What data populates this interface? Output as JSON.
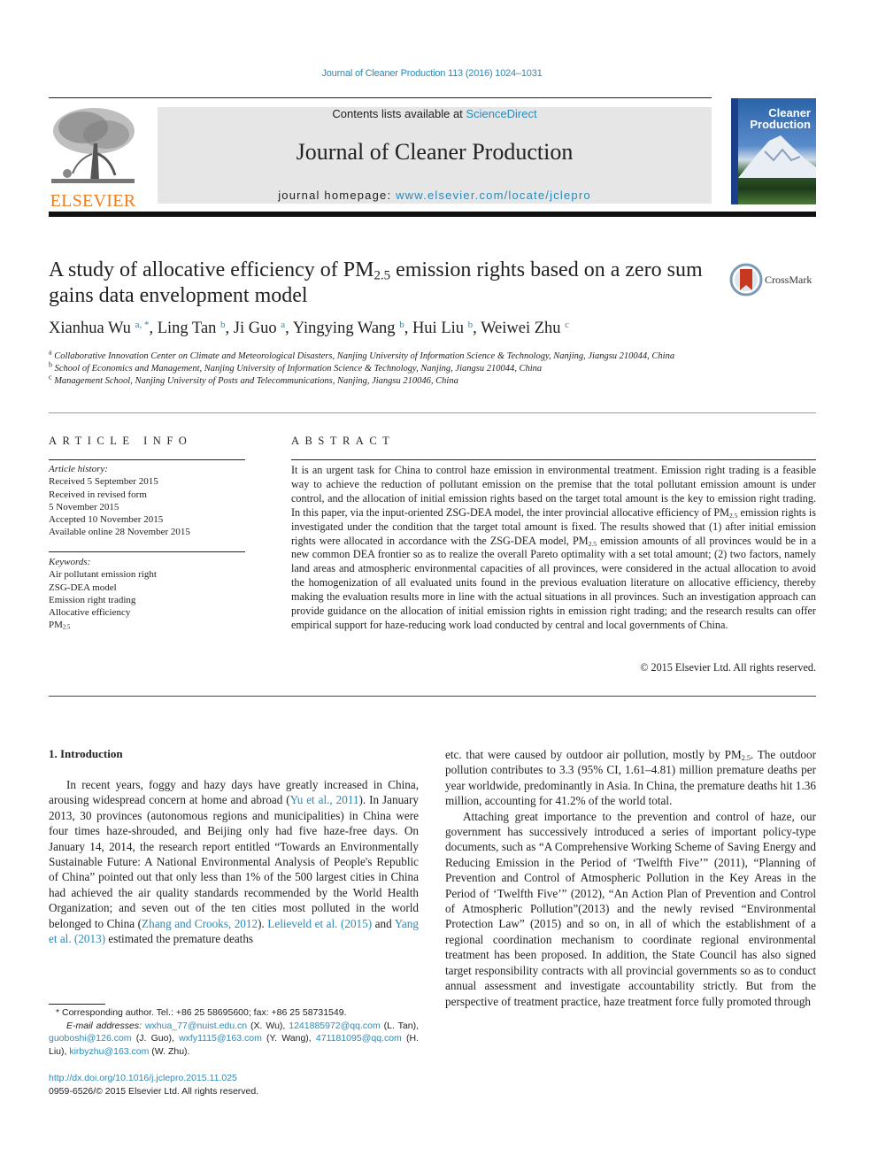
{
  "citation": "Journal of Cleaner Production 113 (2016) 1024–1031",
  "header": {
    "publisher_logo_text": "ELSEVIER",
    "contents_prefix": "Contents lists available at ",
    "contents_link": "ScienceDirect",
    "journal_name": "Journal of Cleaner Production",
    "homepage_prefix": "journal homepage: ",
    "homepage_link": "www.elsevier.com/locate/jclepro",
    "cover_title_line1": "Cleaner",
    "cover_title_line2": "Production",
    "colors": {
      "link": "#2a8ab8",
      "elsevier_orange": "#f07d1e",
      "banner_bg": "#e6e6e6"
    }
  },
  "article": {
    "title_part1": "A study of allocative efficiency of PM",
    "title_sub": "2.5",
    "title_part2": " emission rights based on a zero sum gains data envelopment model",
    "crossmark_label": "CrossMark",
    "authors": [
      {
        "name": "Xianhua Wu",
        "sup": "a, *"
      },
      {
        "name": "Ling Tan",
        "sup": "b"
      },
      {
        "name": "Ji Guo",
        "sup": "a"
      },
      {
        "name": "Yingying Wang",
        "sup": "b"
      },
      {
        "name": "Hui Liu",
        "sup": "b"
      },
      {
        "name": "Weiwei Zhu",
        "sup": "c"
      }
    ],
    "affiliations": [
      {
        "mark": "a",
        "text": "Collaborative Innovation Center on Climate and Meteorological Disasters, Nanjing University of Information Science & Technology, Nanjing, Jiangsu 210044, China"
      },
      {
        "mark": "b",
        "text": "School of Economics and Management, Nanjing University of Information Science & Technology, Nanjing, Jiangsu 210044, China"
      },
      {
        "mark": "c",
        "text": "Management School, Nanjing University of Posts and Telecommunications, Nanjing, Jiangsu 210046, China"
      }
    ]
  },
  "article_info": {
    "heading": "ARTICLE INFO",
    "history_label": "Article history:",
    "history": [
      "Received 5 September 2015",
      "Received in revised form",
      "5 November 2015",
      "Accepted 10 November 2015",
      "Available online 28 November 2015"
    ],
    "keywords_label": "Keywords:",
    "keywords": [
      "Air pollutant emission right",
      "ZSG-DEA model",
      "Emission right trading",
      "Allocative efficiency"
    ],
    "keyword_pm": "PM",
    "keyword_pm_sub": "2.5"
  },
  "abstract": {
    "heading": "ABSTRACT",
    "part1": "It is an urgent task for China to control haze emission in environmental treatment. Emission right trading is a feasible way to achieve the reduction of pollutant emission on the premise that the total pollutant emission amount is under control, and the allocation of initial emission rights based on the target total amount is the key to emission right trading. In this paper, via the input-oriented ZSG-DEA model, the inter provincial allocative efficiency of PM",
    "sub1": "2.5",
    "part2": " emission rights is investigated under the condition that the target total amount is fixed. The results showed that (1) after initial emission rights were allocated in accordance with the ZSG-DEA model, PM",
    "sub2": "2.5",
    "part3": " emission amounts of all provinces would be in a new common DEA frontier so as to realize the overall Pareto optimality with a set total amount; (2) two factors, namely land areas and atmospheric environmental capacities of all provinces, were considered in the actual allocation to avoid the homogenization of all evaluated units found in the previous evaluation literature on allocative efficiency, thereby making the evaluation results more in line with the actual situations in all provinces. Such an investigation approach can provide guidance on the allocation of initial emission rights in emission right trading; and the research results can offer empirical support for haze-reducing work load conducted by central and local governments of China.",
    "copyright": "© 2015 Elsevier Ltd. All rights reserved."
  },
  "body": {
    "intro_heading": "1.  Introduction",
    "left": {
      "t1": "In recent years, foggy and hazy days have greatly increased in China, arousing widespread concern at home and abroad (",
      "ref1": "Yu et al., 2011",
      "t2": "). In January 2013, 30 provinces (autonomous regions and municipalities) in China were four times haze-shrouded, and Beijing only had five haze-free days. On January 14, 2014, the research report entitled “Towards an Environmentally Sustainable Future: A National Environmental Analysis of People's Republic of China” pointed out that only less than 1% of the 500 largest cities in China had achieved the air quality standards recommended by the World Health Organization; and seven out of the ten cities most polluted in the world belonged to China (",
      "ref2": "Zhang and Crooks, 2012",
      "t3": "). ",
      "ref3": "Lelieveld et al. (2015)",
      "t4": " and ",
      "ref4": "Yang et al. (2013)",
      "t5": " estimated the premature deaths"
    },
    "right": {
      "p1a": "etc. that were caused by outdoor air pollution, mostly by PM",
      "p1sub": "2.5",
      "p1b": ". The outdoor pollution contributes to 3.3 (95% CI, 1.61–4.81) million premature deaths per year worldwide, predominantly in Asia. In China, the premature deaths hit 1.36 million, accounting for 41.2% of the world total.",
      "p2": "Attaching great importance to the prevention and control of haze, our government has successively introduced a series of important policy-type documents, such as “A Comprehensive Working Scheme of Saving Energy and Reducing Emission in the Period of ‘Twelfth Five’” (2011), “Planning of Prevention and Control of Atmospheric Pollution in the Key Areas in the Period of ‘Twelfth Five’” (2012), “An Action Plan of Prevention and Control of Atmospheric Pollution”(2013) and the newly revised “Environmental Protection Law” (2015) and so on, in all of which the establishment of a regional coordination mechanism to coordinate regional environmental treatment has been proposed. In addition, the State Council has also signed target responsibility contracts with all provincial governments so as to conduct annual assessment and investigate accountability strictly. But from the perspective of treatment practice, haze treatment force fully promoted through"
    }
  },
  "footnotes": {
    "corresponding": "* Corresponding author. Tel.: +86 25 58695600; fax: +86 25 58731549.",
    "email_label": "E-mail addresses:",
    "emails": [
      {
        "email": "wxhua_77@nuist.edu.cn",
        "who": " (X. Wu), "
      },
      {
        "email": "1241885972@qq.com",
        "who": " (L. Tan), "
      },
      {
        "email": "guoboshi@126.com",
        "who": " (J. Guo), "
      },
      {
        "email": "wxfy1115@163.com",
        "who": " (Y. Wang), "
      },
      {
        "email": "471181095@qq.com",
        "who": " (H. Liu), "
      },
      {
        "email": "kirbyzhu@163.com",
        "who": " (W. Zhu)."
      }
    ],
    "doi": "http://dx.doi.org/10.1016/j.jclepro.2015.11.025",
    "issn": "0959-6526/© 2015 Elsevier Ltd. All rights reserved."
  }
}
